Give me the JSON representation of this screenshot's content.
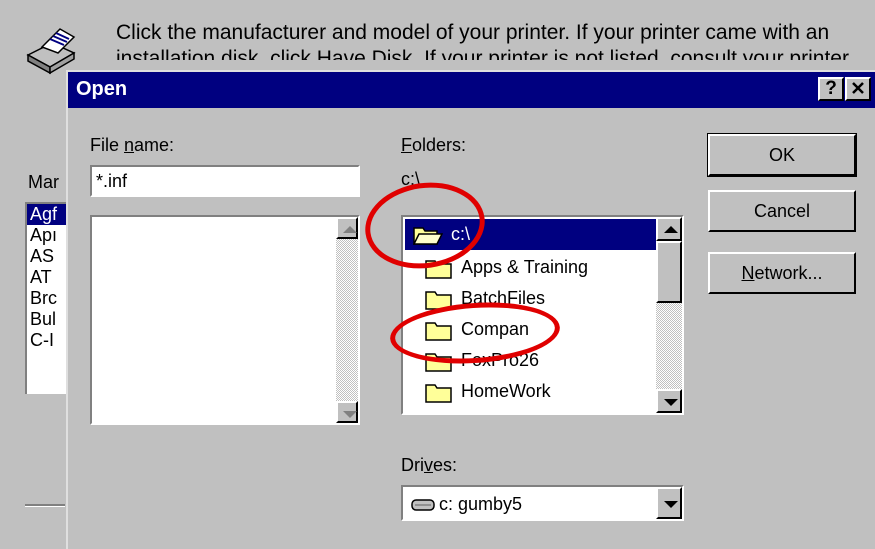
{
  "background": {
    "description_line1": "Click the manufacturer and model of your printer. If your printer came with an",
    "description_line2": "installation disk, click Have Disk. If your printer is not listed, consult your printer ...",
    "manufacturers_label": "Mar",
    "manufacturers": [
      "Agf",
      "Apı",
      "AS",
      "AT",
      "Brc",
      "Bul",
      "C-I"
    ]
  },
  "dialog": {
    "title": "Open",
    "help_button": "?",
    "close_button": "×",
    "file_name_label": "File name:",
    "file_name_value": "*.inf",
    "folders_label": "Folders:",
    "current_path": "c:\\",
    "folders": [
      "c:\\",
      "Apps & Training",
      "BatchFiles",
      "Compan",
      "FoxPro26",
      "HomeWork"
    ],
    "drives_label": "Drives:",
    "drive_value": "c: gumby5",
    "ok_button": "OK",
    "cancel_button": "Cancel",
    "network_button": "Network..."
  },
  "colors": {
    "titlebar": "#000080",
    "face": "#c0c0c0",
    "annotation": "#e00000",
    "folder": "#ffff99"
  }
}
